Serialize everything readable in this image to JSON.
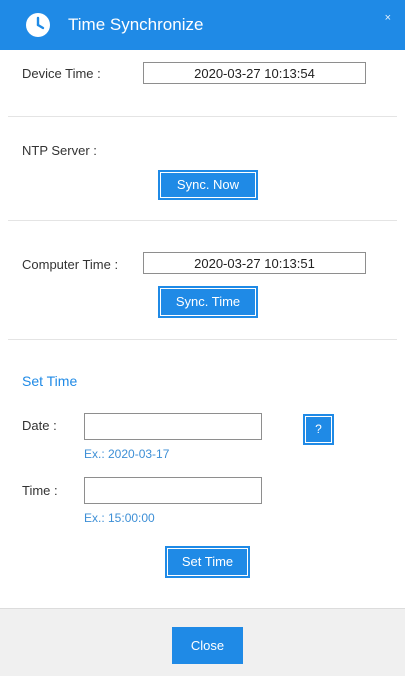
{
  "titlebar": {
    "title": "Time Synchronize",
    "close_glyph": "×",
    "icon": "clock-icon"
  },
  "device_time": {
    "label": "Device Time :",
    "value": "2020-03-27 10:13:54"
  },
  "ntp": {
    "label": "NTP Server :",
    "button": "Sync. Now"
  },
  "computer_time": {
    "label": "Computer Time :",
    "value": "2020-03-27 10:13:51",
    "button": "Sync. Time"
  },
  "set_time": {
    "heading": "Set Time",
    "date_label": "Date :",
    "date_value": "",
    "date_hint": "Ex.: 2020-03-17",
    "help_button": "?",
    "time_label": "Time :",
    "time_value": "",
    "time_hint": "Ex.: 15:00:00",
    "button": "Set Time"
  },
  "footer": {
    "close_button": "Close"
  },
  "colors": {
    "accent": "#1f8ae6",
    "footer_bg": "#f0f0f0",
    "hint": "#3d8fd6"
  }
}
